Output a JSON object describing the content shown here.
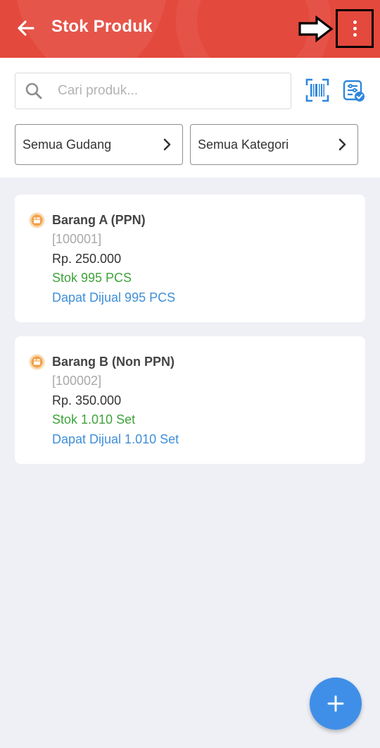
{
  "header": {
    "title": "Stok Produk",
    "back_icon": "arrow-left-icon",
    "more_icon": "more-vertical-icon",
    "annotation_icon": "outline-arrow-right-icon",
    "color": "#e4493d"
  },
  "search": {
    "placeholder": "Cari produk...",
    "value": "",
    "barcode_icon": "barcode-scan-icon",
    "filter_icon": "filter-settings-icon"
  },
  "filters": {
    "warehouse_label": "Semua Gudang",
    "category_label": "Semua Kategori"
  },
  "products": [
    {
      "name": "Barang A (PPN)",
      "code": "[100001]",
      "price": "Rp. 250.000",
      "stock": "Stok 995 PCS",
      "sellable": "Dapat Dijual 995 PCS",
      "icon": "product-box-icon"
    },
    {
      "name": "Barang B (Non PPN)",
      "code": "[100002]",
      "price": "Rp. 350.000",
      "stock": "Stok 1.010 Set",
      "sellable": "Dapat Dijual 1.010 Set",
      "icon": "product-box-icon"
    }
  ],
  "fab": {
    "icon": "plus-icon",
    "color": "#3f8fe8"
  },
  "colors": {
    "stock": "#3ea33a",
    "sellable": "#3f8fd8",
    "icon_blue": "#2e86de",
    "product_icon": "#f2a14b"
  }
}
